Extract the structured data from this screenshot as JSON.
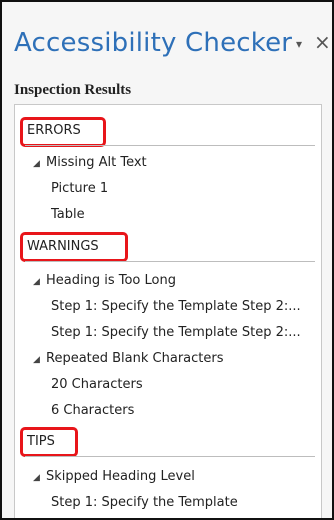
{
  "pane": {
    "title": "Accessibility Checker",
    "dropdown_glyph": "▾",
    "close_glyph": "×",
    "subtitle": "Inspection Results"
  },
  "sections": {
    "errors": {
      "label": "ERRORS",
      "group": "Missing Alt Text",
      "items": [
        "Picture 1",
        "Table"
      ]
    },
    "warnings": {
      "label": "WARNINGS",
      "group1": "Heading is Too Long",
      "items1": [
        "Step 1: Specify the Template Step 2:...",
        "Step 1: Specify the Template Step 2:..."
      ],
      "group2": "Repeated Blank Characters",
      "items2": [
        "20 Characters",
        "6 Characters"
      ]
    },
    "tips": {
      "label": "TIPS",
      "group": "Skipped Heading Level",
      "items": [
        "Step 1: Specify the Template"
      ]
    }
  },
  "icons": {
    "expanded_arrow": "◢",
    "highlight_color": "#e8151a",
    "title_color": "#2e70b8"
  }
}
